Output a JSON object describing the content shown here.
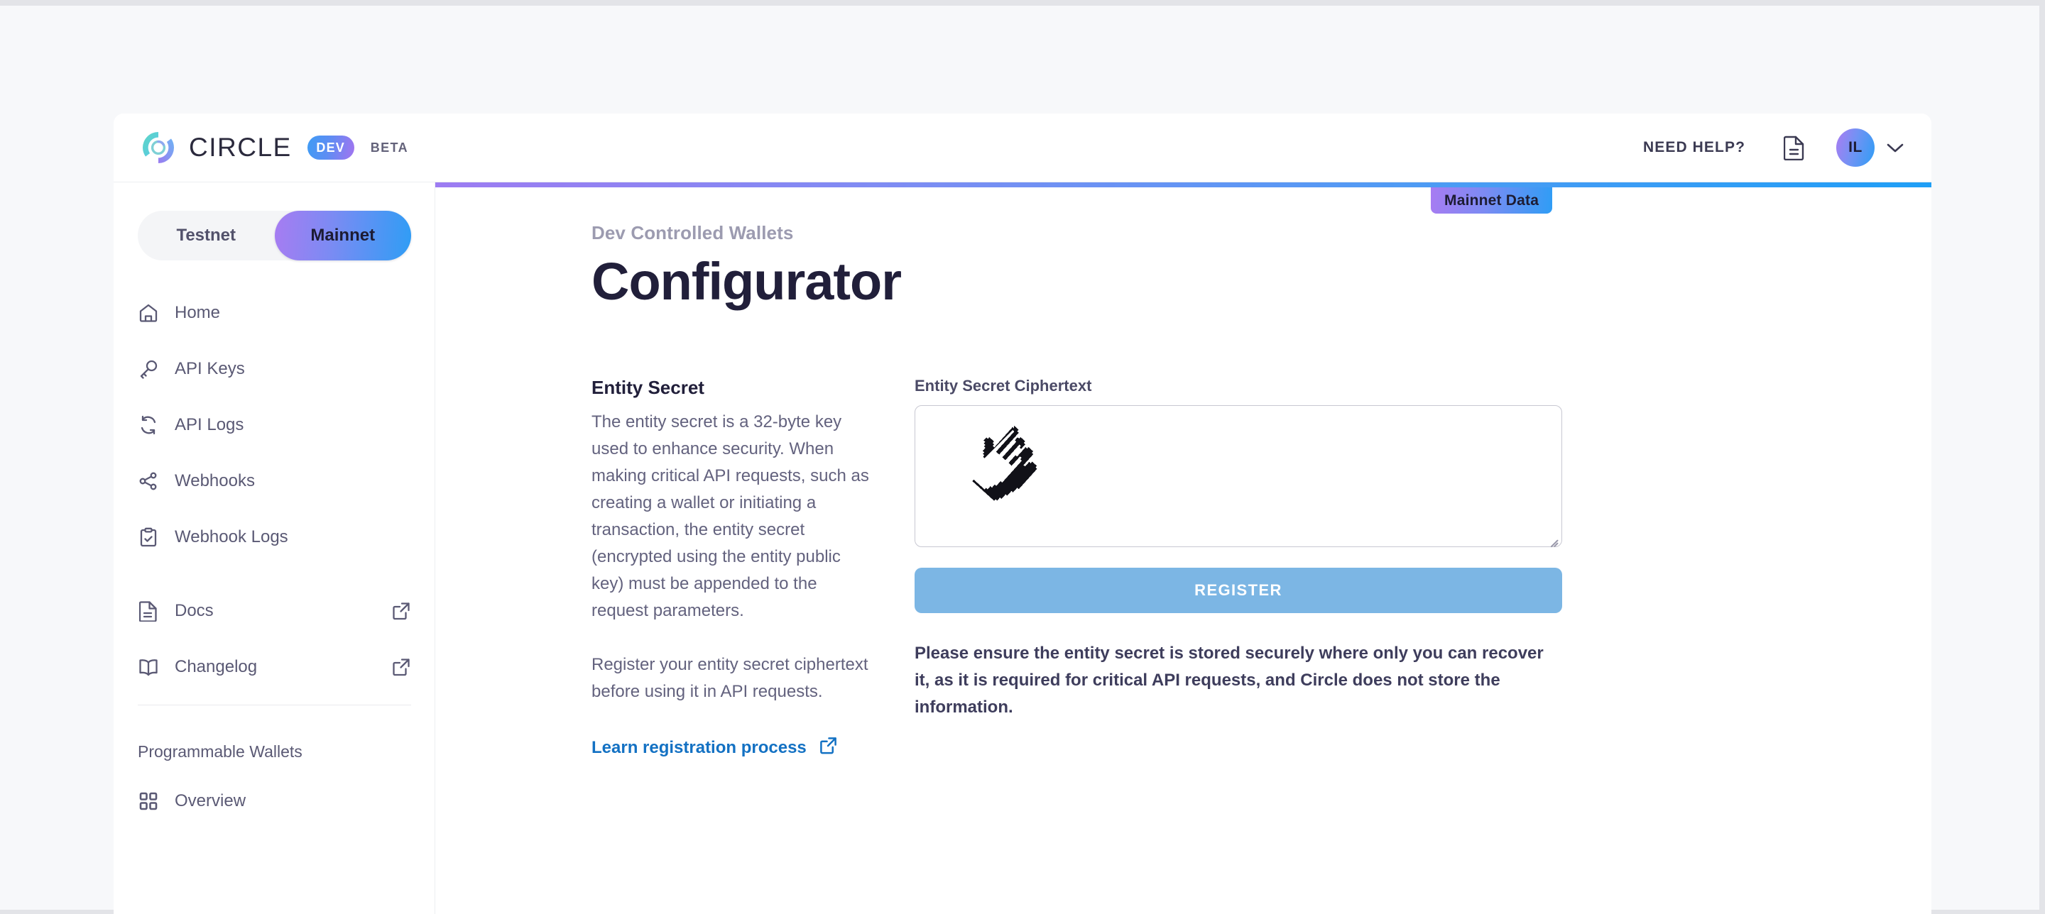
{
  "brand": {
    "wordmark": "CIRCLE",
    "dev_pill": "DEV",
    "beta": "BETA",
    "logo_icon": "circle-logo-icon"
  },
  "header": {
    "need_help": "NEED HELP?",
    "doc_icon": "document-icon",
    "avatar_initials": "IL",
    "chevron_icon": "chevron-down-icon"
  },
  "sidebar": {
    "network_toggle": {
      "options": [
        "Testnet",
        "Mainnet"
      ],
      "selected": "Mainnet"
    },
    "items": [
      {
        "label": "Home",
        "icon": "home-icon",
        "external": false
      },
      {
        "label": "API Keys",
        "icon": "key-icon",
        "external": false
      },
      {
        "label": "API Logs",
        "icon": "refresh-icon",
        "external": false
      },
      {
        "label": "Webhooks",
        "icon": "share-nodes-icon",
        "external": false
      },
      {
        "label": "Webhook Logs",
        "icon": "clipboard-check-icon",
        "external": false
      }
    ],
    "links": [
      {
        "label": "Docs",
        "icon": "document-icon",
        "external": true
      },
      {
        "label": "Changelog",
        "icon": "book-icon",
        "external": true
      }
    ],
    "section_title": "Programmable Wallets",
    "section_items": [
      {
        "label": "Overview",
        "icon": "grid-icon",
        "external": false
      }
    ]
  },
  "main": {
    "env_badge": "Mainnet Data",
    "eyebrow": "Dev Controlled Wallets",
    "title": "Configurator",
    "left_column": {
      "heading": "Entity Secret",
      "paragraph_1": "The entity secret is a 32-byte key used to enhance security. When making critical API requests, such as creating a wallet or initiating a transaction, the entity secret (encrypted using the entity public key) must be appended to the request parameters.",
      "paragraph_2": "Register your entity secret ciphertext before using it in API requests.",
      "link_label": "Learn registration process",
      "link_icon": "external-link-icon"
    },
    "right_column": {
      "field_label": "Entity Secret Ciphertext",
      "ciphertext_value": "",
      "ciphertext_placeholder": "",
      "register_label": "REGISTER",
      "warning": "Please ensure the entity secret is stored securely where only you can recover it, as it is required for critical API requests, and Circle does not store the information."
    }
  },
  "colors": {
    "accent_blue": "#1f9ff6",
    "accent_purple": "#a77cf2",
    "link_blue": "#1371c3",
    "button_blue": "#7cb6e4",
    "text_dark": "#211f3a",
    "text_muted": "#63627e"
  }
}
